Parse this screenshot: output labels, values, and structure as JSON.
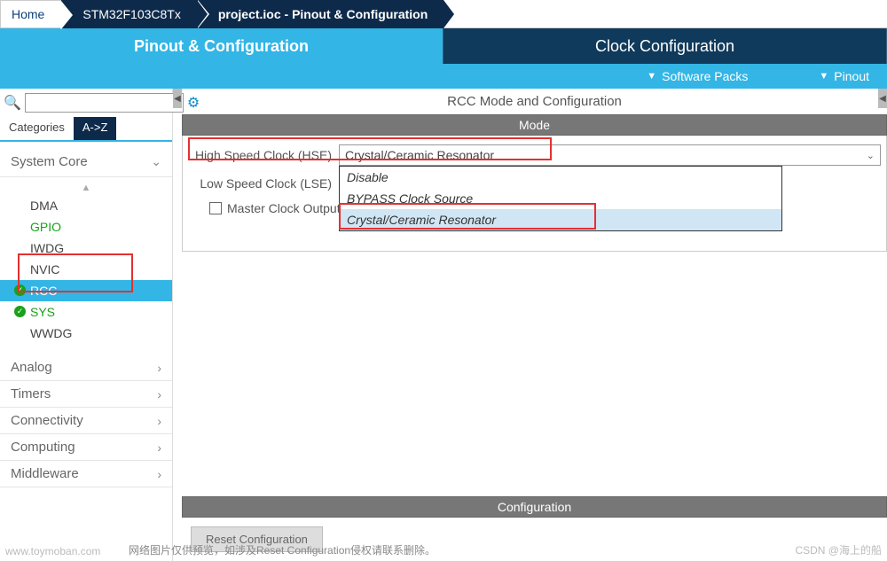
{
  "breadcrumb": {
    "home": "Home",
    "chip": "STM32F103C8Tx",
    "file": "project.ioc - Pinout & Configuration"
  },
  "tabs": {
    "pinout": "Pinout & Configuration",
    "clock": "Clock Configuration"
  },
  "dropbar": {
    "packs": "Software Packs",
    "pinout": "Pinout"
  },
  "sidebar": {
    "cat_label": "Categories",
    "sort_label": "A->Z",
    "sections": {
      "core": "System Core",
      "analog": "Analog",
      "timers": "Timers",
      "connectivity": "Connectivity",
      "computing": "Computing",
      "middleware": "Middleware"
    },
    "core_items": {
      "dma": "DMA",
      "gpio": "GPIO",
      "iwdg": "IWDG",
      "nvic": "NVIC",
      "rcc": "RCC",
      "sys": "SYS",
      "wwdg": "WWDG"
    }
  },
  "panel": {
    "title": "RCC Mode and Configuration",
    "mode_header": "Mode",
    "config_header": "Configuration",
    "hse_label": "High Speed Clock (HSE)",
    "hse_value": "Crystal/Ceramic Resonator",
    "lse_label": "Low Speed Clock (LSE)",
    "mco_label": "Master Clock Output",
    "options": {
      "disable": "Disable",
      "bypass": "BYPASS Clock Source",
      "crystal": "Crystal/Ceramic Resonator"
    },
    "reset_btn": "Reset Configuration"
  },
  "watermarks": {
    "w1": "www.toymoban.com",
    "w2": "网络图片仅供预览，如涉及Reset Configuration侵权请联系删除。",
    "w3": "CSDN @海上的船"
  }
}
